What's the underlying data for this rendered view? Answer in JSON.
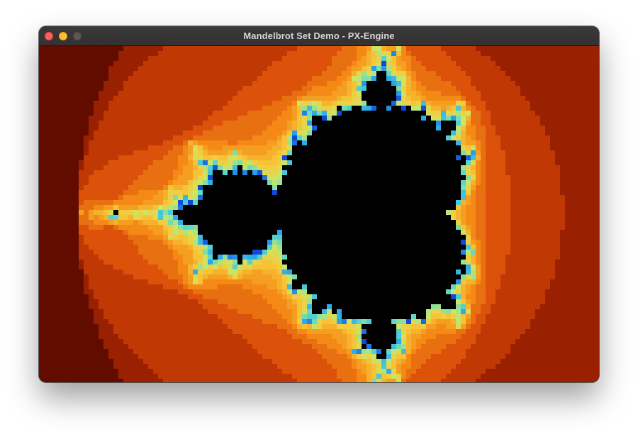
{
  "window": {
    "title": "Mandelbrot Set Demo - PX-Engine"
  },
  "traffic_lights": {
    "close_color": "#ff5f57",
    "minimize_color": "#febc2e",
    "zoom_color": "#5b5859"
  },
  "render": {
    "kind": "mandelbrot-set",
    "re_min": -2.23,
    "re_max": 1.22,
    "im_center": 0.0,
    "max_iterations": 60,
    "interior_color": "#000000",
    "palette": [
      "#000000",
      "#3a0300",
      "#6e0f00",
      "#a22400",
      "#d84a08",
      "#f58a16",
      "#f6c93a",
      "#c8e86a",
      "#5ad8c8",
      "#2aa8ee",
      "#1048d8"
    ]
  }
}
